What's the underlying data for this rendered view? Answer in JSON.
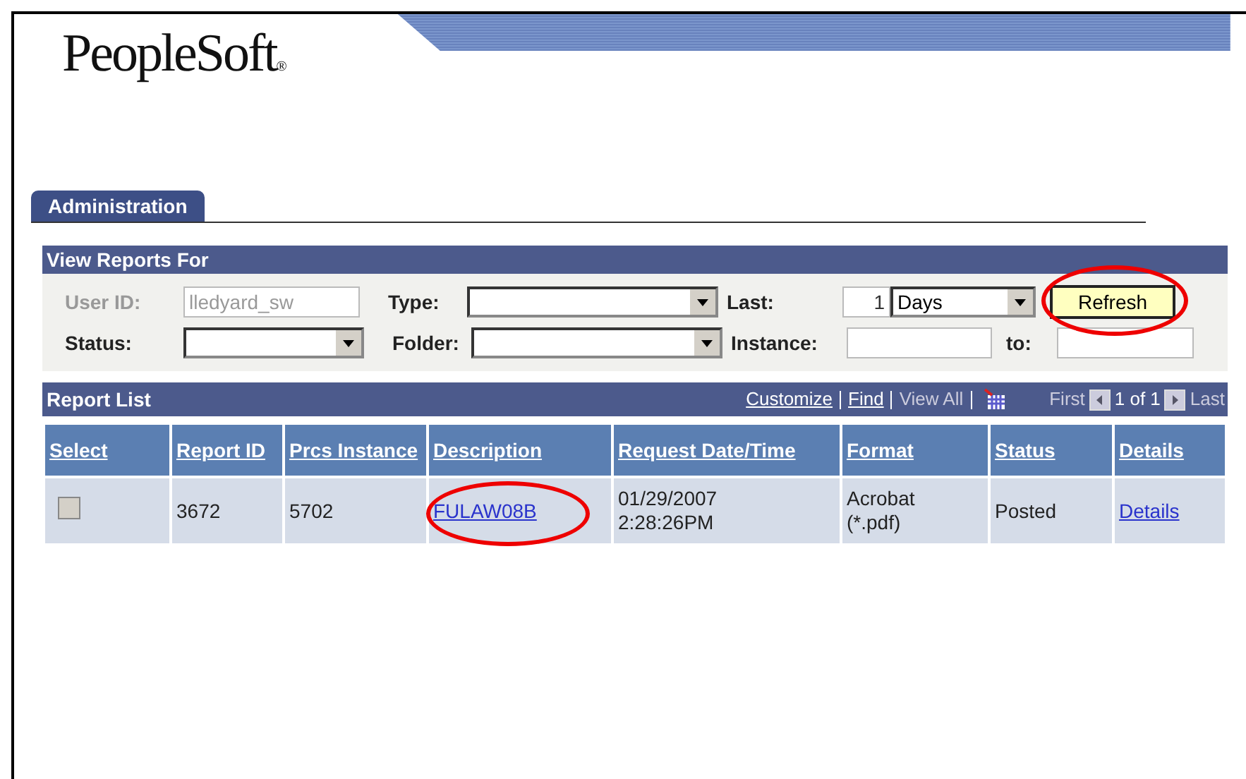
{
  "logo": "PeopleSoft",
  "logo_mark": "®",
  "tabs": [
    {
      "label": "Administration",
      "selected": true
    }
  ],
  "filter": {
    "title": "View Reports For",
    "user_id": {
      "label": "User ID:",
      "value": "lledyard_sw",
      "disabled": true
    },
    "type": {
      "label": "Type:"
    },
    "last": {
      "label": "Last:",
      "value": "1",
      "unit": "Days"
    },
    "refresh_button": "Refresh",
    "status": {
      "label": "Status:"
    },
    "folder": {
      "label": "Folder:"
    },
    "instance": {
      "label": "Instance:"
    },
    "to": {
      "label": "to:"
    }
  },
  "report_list": {
    "title": "Report List",
    "links": [
      "Customize",
      "Find"
    ],
    "view_all": "View All",
    "first": "First",
    "page": "1 of 1",
    "last": "Last",
    "columns": [
      "Select",
      "Report ID",
      "Prcs Instance",
      "Description",
      "Request Date/Time",
      "Format",
      "Status",
      "Details"
    ],
    "rows": [
      {
        "checked": false,
        "report_id": "3672",
        "prcs_instance": "5702",
        "description": "FULAW08B",
        "date": "01/29/2007",
        "time": "2:28:26PM",
        "format": "Acrobat",
        "format_ext": "(*.pdf)",
        "status": "Posted",
        "details": "Details"
      }
    ]
  }
}
